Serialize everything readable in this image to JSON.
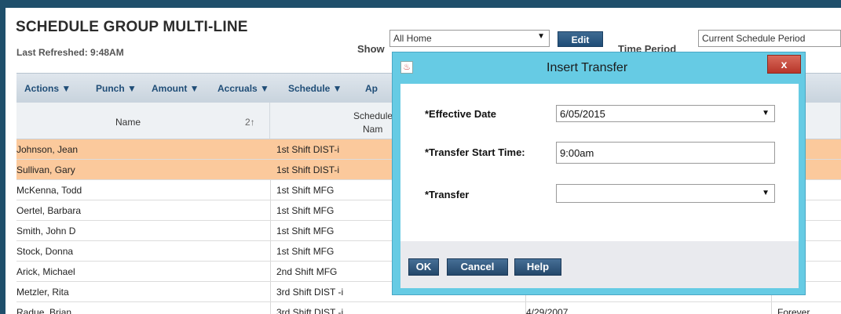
{
  "header": {
    "title": "SCHEDULE GROUP MULTI-LINE",
    "last_refreshed": "Last Refreshed: 9:48AM",
    "show_label": "Show",
    "show_value": "All Home",
    "edit_label": "Edit",
    "time_period_label": "Time Period",
    "time_period_value": "Current Schedule Period"
  },
  "toolbar": {
    "actions": "Actions ▼",
    "punch": "Punch ▼",
    "amount": "Amount ▼",
    "accruals": "Accruals ▼",
    "schedule": "Schedule ▼",
    "ap": "Ap"
  },
  "table": {
    "col_name": "Name",
    "col_name_sort": "2↑",
    "col_schedule_line1": "Schedule",
    "col_schedule_line2": "Nam",
    "rows": [
      {
        "name": "Johnson, Jean",
        "schedule": "1st Shift DIST-i",
        "date": "",
        "end": "ever",
        "selected": true
      },
      {
        "name": "Sullivan, Gary",
        "schedule": "1st Shift DIST-i",
        "date": "",
        "end": "ever",
        "selected": true
      },
      {
        "name": "McKenna, Todd",
        "schedule": "1st Shift MFG",
        "date": "",
        "end": "ever",
        "selected": false
      },
      {
        "name": "Oertel, Barbara",
        "schedule": "1st Shift MFG",
        "date": "",
        "end": "ever",
        "selected": false
      },
      {
        "name": "Smith, John D",
        "schedule": "1st Shift MFG",
        "date": "",
        "end": "ever",
        "selected": false
      },
      {
        "name": "Stock, Donna",
        "schedule": "1st Shift MFG",
        "date": "",
        "end": "ever",
        "selected": false
      },
      {
        "name": "Arick, Michael",
        "schedule": "2nd Shift MFG",
        "date": "",
        "end": "ever",
        "selected": false
      },
      {
        "name": "Metzler, Rita",
        "schedule": "3rd Shift DIST -i",
        "date": "",
        "end": "ever",
        "selected": false
      },
      {
        "name": "Radue, Brian",
        "schedule": "3rd Shift DIST -i",
        "date": "4/29/2007",
        "end": "Forever",
        "selected": false
      }
    ]
  },
  "dialog": {
    "title": "Insert Transfer",
    "close_label": "x",
    "effective_date_label": "*Effective Date",
    "effective_date_value": "6/05/2015",
    "start_time_label": "*Transfer Start Time:",
    "start_time_value": "9:00am",
    "transfer_label": "*Transfer",
    "transfer_value": "",
    "ok_label": "OK",
    "cancel_label": "Cancel",
    "help_label": "Help"
  },
  "colors": {
    "selected_row": "#fbc99c",
    "dialog_frame": "#66cbe4",
    "button_blue": "#24486b",
    "close_red": "#b7362a"
  },
  "icons": {
    "dropdown": "chevron-down-icon",
    "java": "java-cup-icon",
    "close": "close-icon"
  }
}
